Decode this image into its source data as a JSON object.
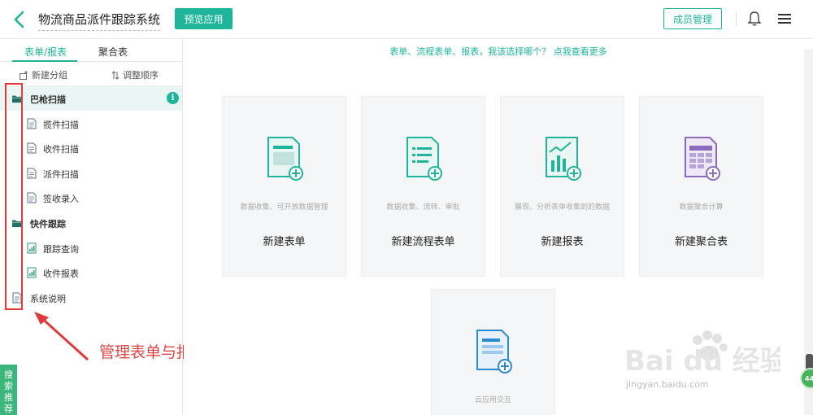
{
  "header": {
    "app_title": "物流商品派件跟踪系统",
    "preview_label": "预览应用",
    "members_label": "成员管理"
  },
  "sidebar": {
    "tabs": [
      {
        "label": "表单/报表",
        "active": true
      },
      {
        "label": "聚合表",
        "active": false
      }
    ],
    "toolbar": {
      "new_group": "新建分组",
      "reorder": "调整顺序"
    },
    "tree": [
      {
        "label": "巴枪扫描",
        "type": "folder",
        "selected": true,
        "info": "i"
      },
      {
        "label": "揽件扫描",
        "type": "form"
      },
      {
        "label": "收件扫描",
        "type": "form"
      },
      {
        "label": "派件扫描",
        "type": "form"
      },
      {
        "label": "签收录入",
        "type": "form"
      },
      {
        "label": "快件跟踪",
        "type": "folder"
      },
      {
        "label": "跟踪查询",
        "type": "report"
      },
      {
        "label": "收件报表",
        "type": "report"
      },
      {
        "label": "系统说明",
        "type": "form"
      }
    ],
    "search_tab": "搜索推荐"
  },
  "annotation": {
    "text": "管理表单与报表",
    "color": "#e04545"
  },
  "main": {
    "tip": "表单、流程表单、报表，我该选择哪个？ 点我查看更多",
    "cards": [
      {
        "name": "新建表单",
        "desc": "数据收集、可开放数据管理",
        "icon": "form-add-icon"
      },
      {
        "name": "新建流程表单",
        "desc": "数据收集、流转、审批",
        "icon": "flow-form-add-icon"
      },
      {
        "name": "新建报表",
        "desc": "展现、分析表单收集到的数据",
        "icon": "report-add-icon"
      },
      {
        "name": "新建聚合表",
        "desc": "数据聚合计算",
        "icon": "aggregate-add-icon"
      },
      {
        "name": "",
        "desc": "云应用交互",
        "icon": "cloud-app-add-icon"
      }
    ]
  },
  "watermark": {
    "brand": "Bai du 经验",
    "url": "jingyan.baidu.com"
  },
  "bubble_text": "44",
  "colors": {
    "accent": "#1eb59a",
    "annotation_red": "#e03a3a",
    "selected_row": "#e9f6f3"
  }
}
